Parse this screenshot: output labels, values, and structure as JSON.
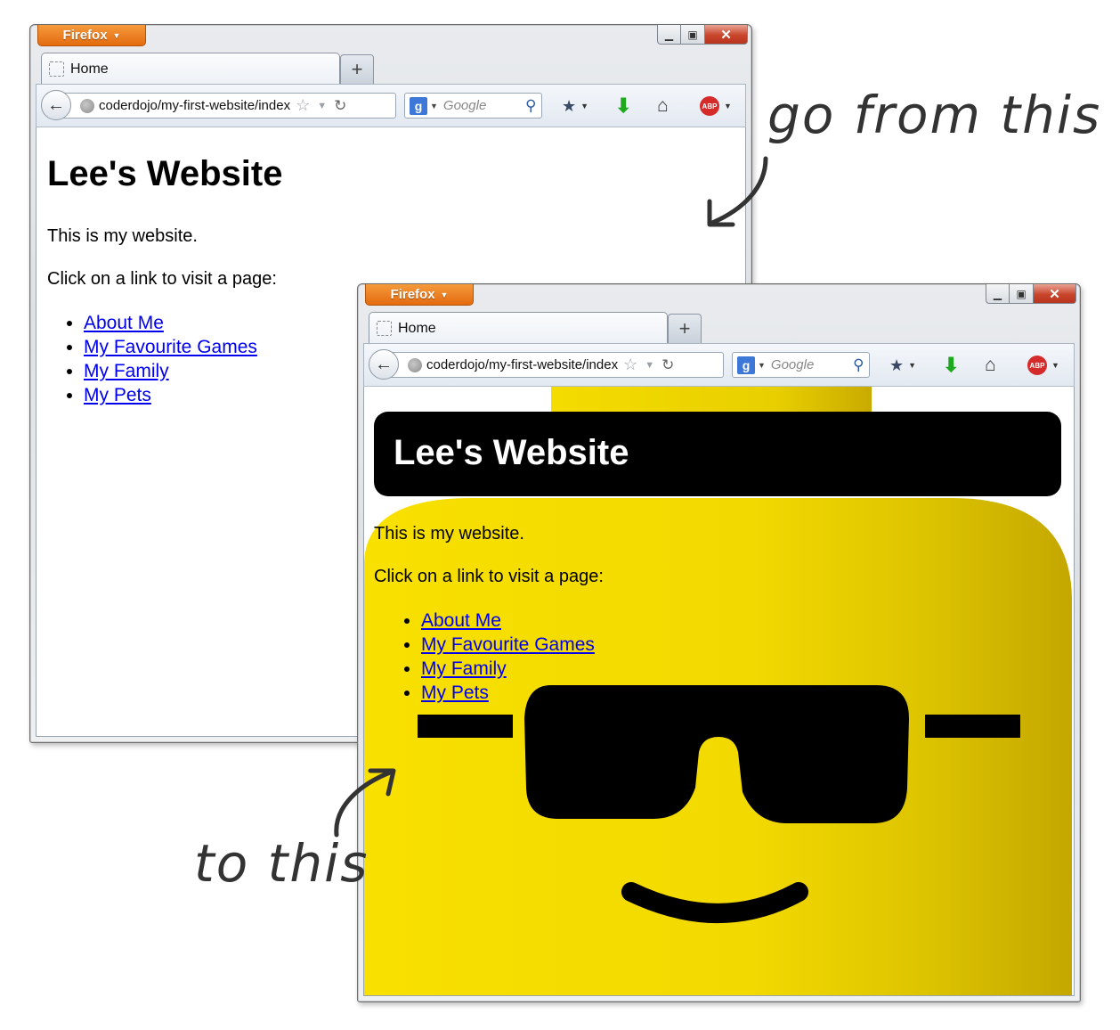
{
  "annotations": {
    "top": "go from this",
    "bottom": "to this"
  },
  "browser": {
    "menu_button": "Firefox",
    "tab_title": "Home",
    "new_tab_symbol": "+",
    "url": "coderdojo/my-first-website/index",
    "search_engine_glyph": "g",
    "search_placeholder": "Google",
    "abp_label": "ABP",
    "icons": [
      "back-arrow-icon",
      "globe-icon",
      "star-icon",
      "reload-icon",
      "google-icon",
      "search-icon",
      "bookmarks-icon",
      "download-icon",
      "home-icon",
      "adblock-icon",
      "minimize-icon",
      "maximize-icon",
      "close-icon"
    ]
  },
  "page_before": {
    "title": "Lee's Website",
    "intro": "This is my website.",
    "prompt": "Click on a link to visit a page:",
    "links": [
      "About Me",
      "My Favourite Games",
      "My Family",
      "My Pets"
    ]
  },
  "page_after": {
    "title": "Lee's Website",
    "intro": "This is my website.",
    "prompt": "Click on a link to visit a page:",
    "links": [
      "About Me",
      "My Favourite Games",
      "My Family",
      "My Pets"
    ],
    "header_background": "#000000",
    "background_theme": "yellow lego head with sunglasses",
    "colors": {
      "yellow": "#f6dc00",
      "yellow_shade": "#c8a800",
      "black": "#000000"
    }
  }
}
